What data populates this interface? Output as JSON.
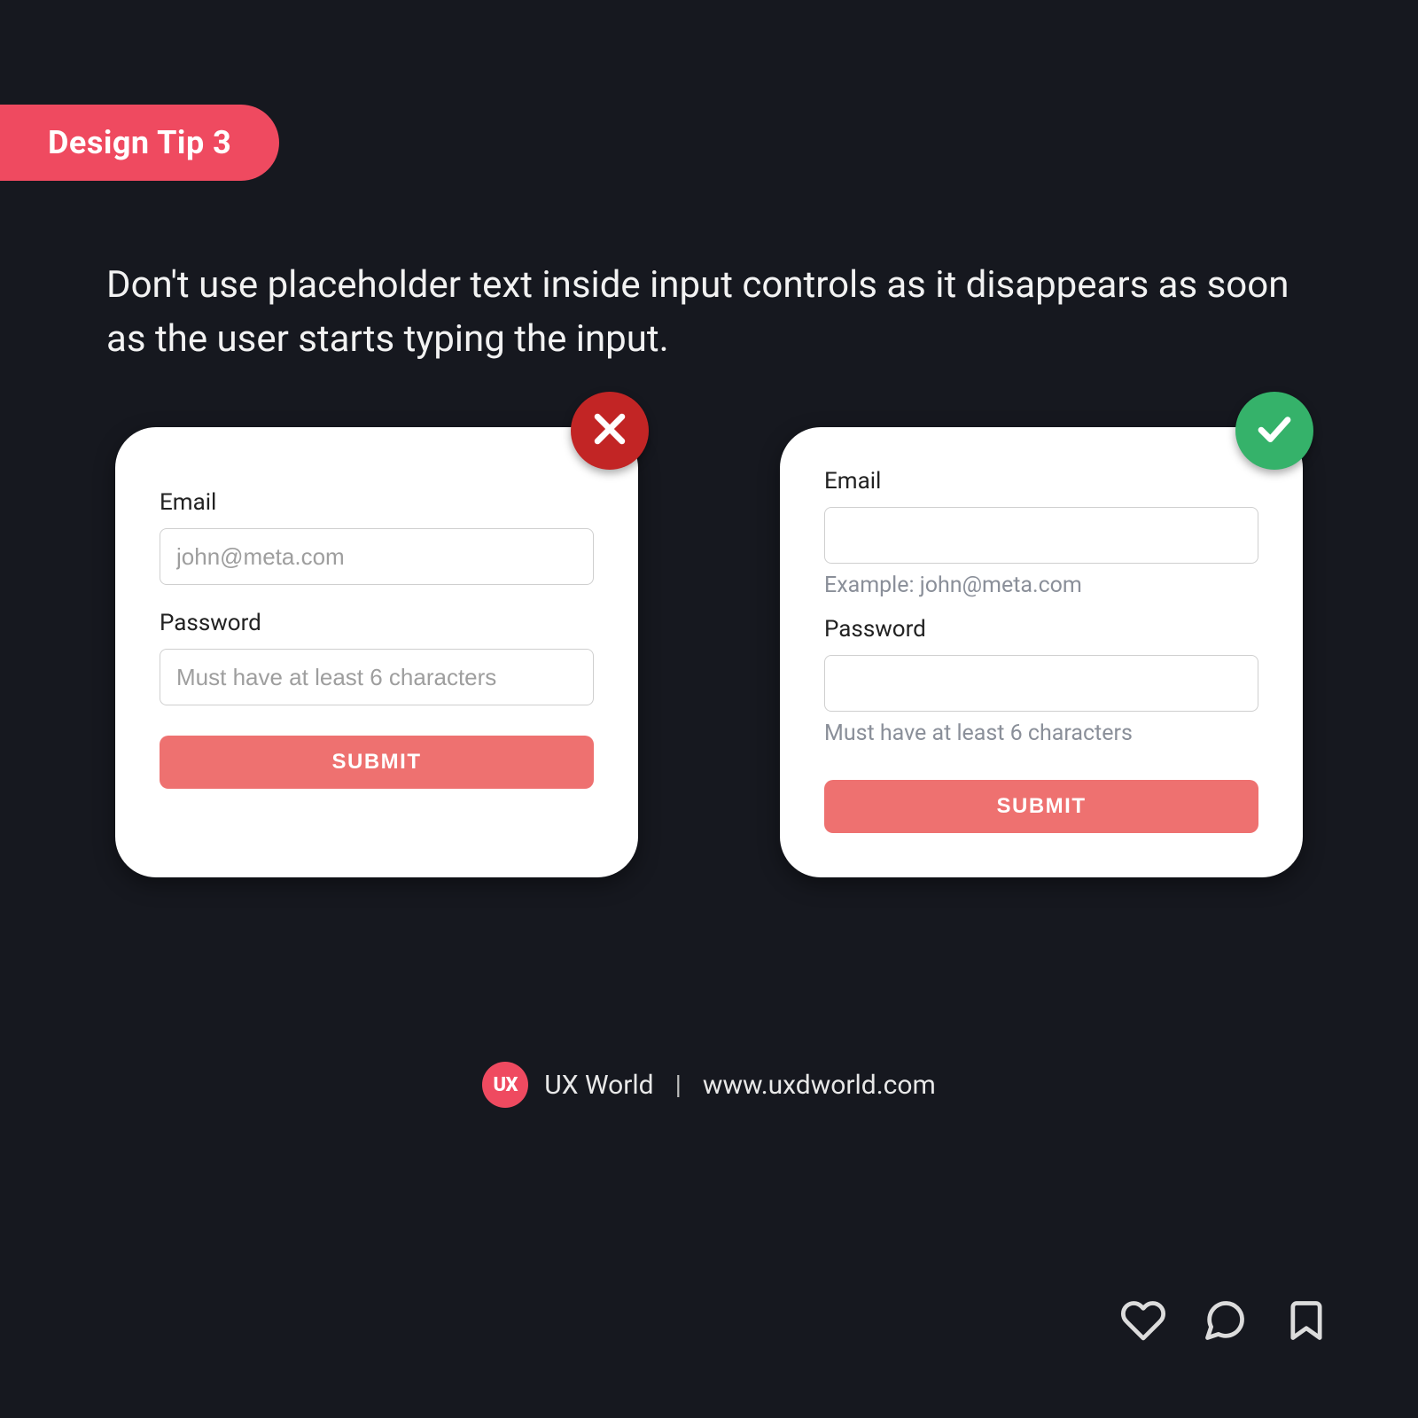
{
  "badge": {
    "label": "Design Tip 3"
  },
  "tip": "Don't use placeholder text inside input controls as it disappears as soon as the user starts typing the input.",
  "card_bad": {
    "email_label": "Email",
    "email_placeholder": "john@meta.com",
    "password_label": "Password",
    "password_placeholder": "Must have at least 6 characters",
    "submit": "SUBMIT"
  },
  "card_good": {
    "email_label": "Email",
    "email_helper": "Example: john@meta.com",
    "password_label": "Password",
    "password_helper": "Must have at least 6 characters",
    "submit": "SUBMIT"
  },
  "footer": {
    "logo": "UX",
    "brand": "UX World",
    "url": "www.uxdworld.com"
  },
  "colors": {
    "bg": "#16181f",
    "accent": "#ef4a60",
    "submit": "#ee7170",
    "bad": "#c22525",
    "good": "#35b26a"
  }
}
